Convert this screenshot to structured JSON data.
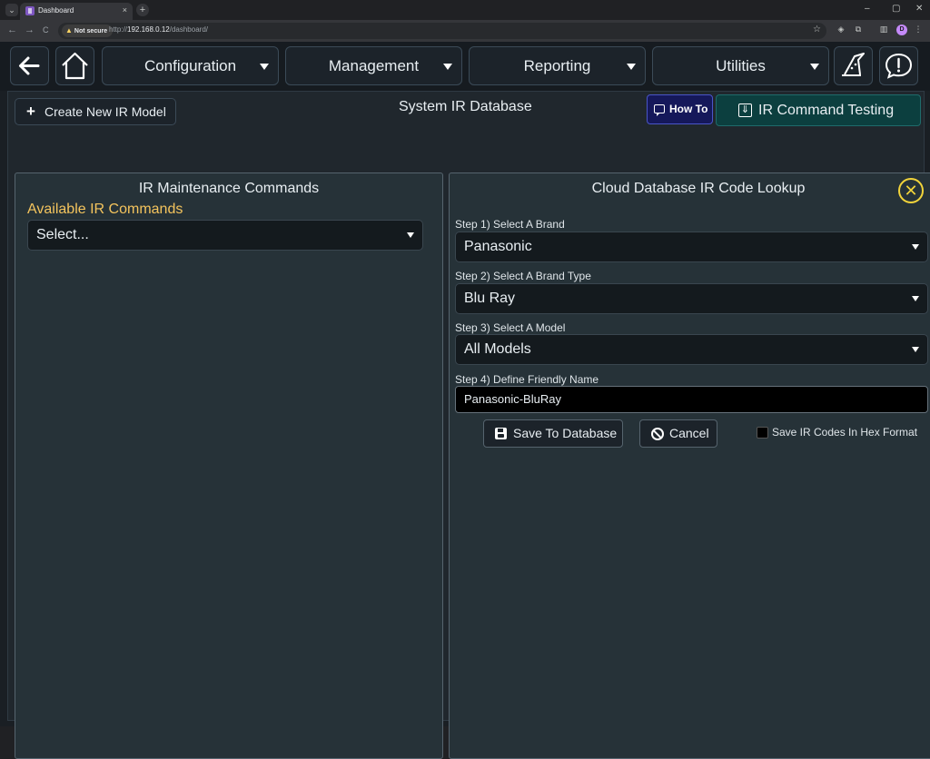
{
  "browser": {
    "tab_title": "Dashboard",
    "tab_close": "×",
    "new_tab": "+",
    "tab_list": "⌄",
    "window_minimize": "–",
    "window_maximize": "▢",
    "window_close": "✕",
    "not_secure": "Not secure",
    "url_scheme": "http://",
    "url_host": "192.168.0.12",
    "url_path": "/dashboard/",
    "profile_initial": "D",
    "nav_back": "←",
    "nav_forward": "→",
    "nav_reload": "C"
  },
  "navbar": {
    "back_icon": "back-arrow-icon",
    "home_icon": "home-icon",
    "menus": [
      "Configuration",
      "Management",
      "Reporting",
      "Utilities"
    ],
    "wizard_icon": "wizard-hat-icon",
    "alert_icon": "alert-bubble-icon"
  },
  "toolbar": {
    "create_button": "Create New IR Model",
    "create_plus": "+",
    "page_title": "System IR Database",
    "howto_button": "How To",
    "ir_testing_button": "IR Command Testing",
    "ir_testing_icon": "⇓"
  },
  "left_panel": {
    "title": "IR Maintenance Commands",
    "available_label": "Available IR Commands",
    "select_value": "Select..."
  },
  "right_panel": {
    "title": "Cloud Database IR Code Lookup",
    "close_symbol": "✕",
    "step1_label": "Step 1) Select A Brand",
    "step1_value": "Panasonic",
    "step2_label": "Step 2) Select A Brand Type",
    "step2_value": "Blu Ray",
    "step3_label": "Step 3) Select A Model",
    "step3_value": "All Models",
    "step4_label": "Step 4) Define Friendly Name",
    "step4_value": "Panasonic-BluRay",
    "save_button": "Save To Database",
    "cancel_button": "Cancel",
    "hex_checkbox_label": "Save IR Codes In Hex Format",
    "hex_checked": false
  },
  "colors": {
    "accent_label": "#f4c45d",
    "close_icon": "#f2d43a",
    "howto_bg": "#15185a",
    "testing_bg": "#0c3f3f"
  }
}
